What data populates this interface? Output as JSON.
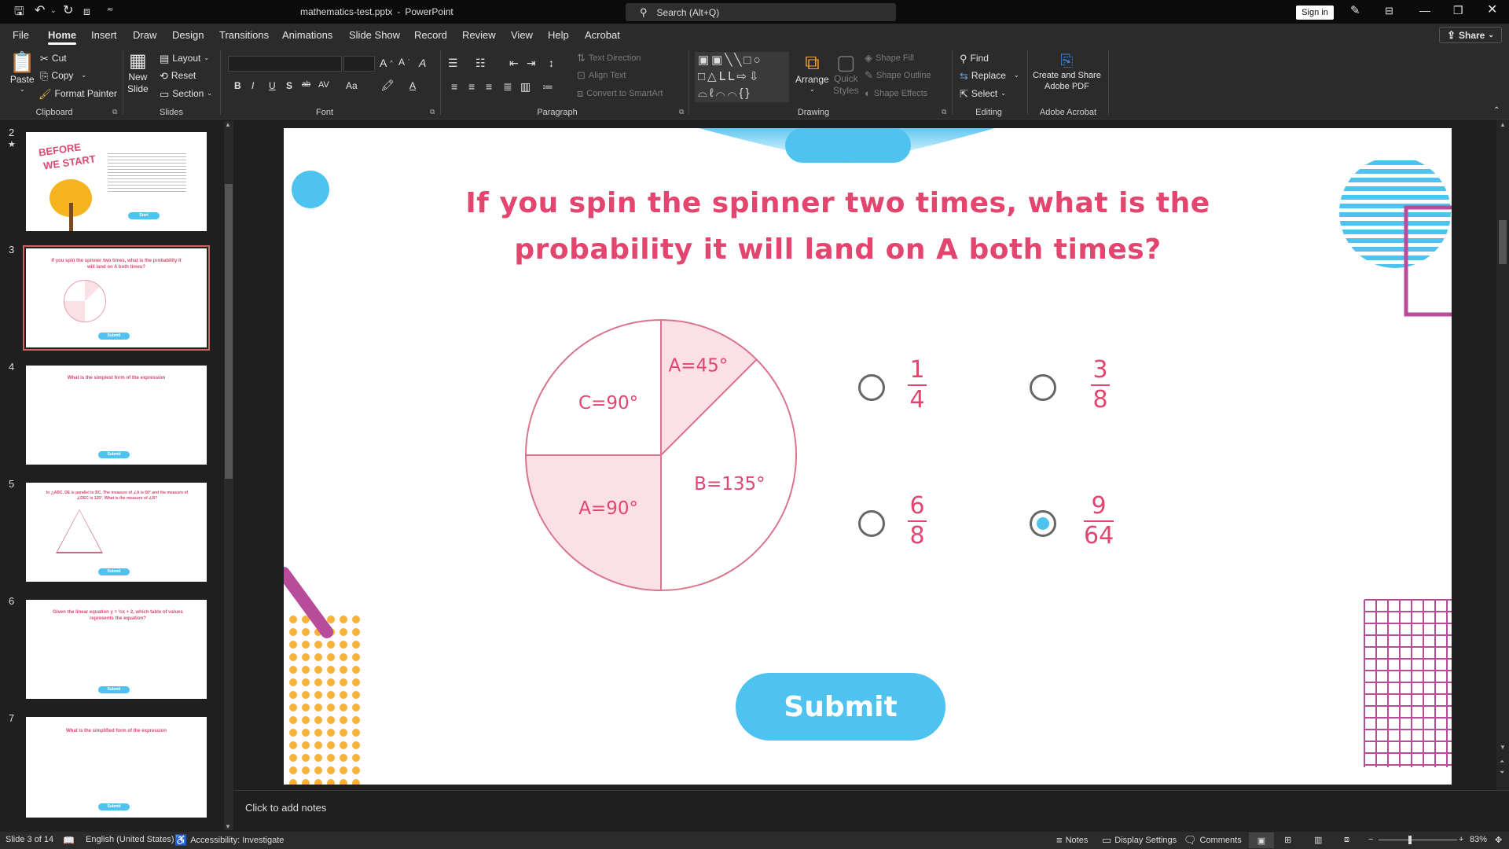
{
  "titlebar": {
    "document_title": "mathematics-test.pptx",
    "separator": "-",
    "app_name": "PowerPoint",
    "search_placeholder": "Search (Alt+Q)",
    "sign_in": "Sign in"
  },
  "tabs": [
    "File",
    "Home",
    "Insert",
    "Draw",
    "Design",
    "Transitions",
    "Animations",
    "Slide Show",
    "Record",
    "Review",
    "View",
    "Help",
    "Acrobat"
  ],
  "active_tab": "Home",
  "share_label": "Share",
  "ribbon": {
    "clipboard": {
      "paste": "Paste",
      "cut": "Cut",
      "copy": "Copy",
      "format_painter": "Format Painter",
      "label": "Clipboard"
    },
    "slides": {
      "new_slide_1": "New",
      "new_slide_2": "Slide",
      "layout": "Layout",
      "reset": "Reset",
      "section": "Section",
      "label": "Slides"
    },
    "font": {
      "label": "Font",
      "font_name": "",
      "font_size": ""
    },
    "paragraph": {
      "text_direction": "Text Direction",
      "align_text": "Align Text",
      "convert_smartart": "Convert to SmartArt",
      "label": "Paragraph"
    },
    "drawing": {
      "arrange": "Arrange",
      "quick_styles_1": "Quick",
      "quick_styles_2": "Styles",
      "shape_fill": "Shape Fill",
      "shape_outline": "Shape Outline",
      "shape_effects": "Shape Effects",
      "label": "Drawing"
    },
    "editing": {
      "find": "Find",
      "replace": "Replace",
      "select": "Select",
      "label": "Editing"
    },
    "acrobat": {
      "create_1": "Create and Share",
      "create_2": "Adobe PDF",
      "label": "Adobe Acrobat"
    }
  },
  "thumbnails": [
    {
      "number": "2",
      "starred": true,
      "title_1": "BEFORE",
      "title_2": "WE START",
      "button": "Start"
    },
    {
      "number": "3",
      "selected": true,
      "title": "If you spin the spinner two times, what is the probability it will land on A both times?",
      "button": "Submit"
    },
    {
      "number": "4",
      "title": "What is the simplest form of the expression",
      "button": "Submit"
    },
    {
      "number": "5",
      "title": "In △ABC, DE is parallel to BC. The measure of ∠A is 60° and the measure of ∠DEC is 125°. What is the measure of ∠B?",
      "button": "Submit"
    },
    {
      "number": "6",
      "title": "Given the linear equation y = ½x + 2, which table of values represents the equation?",
      "button": "Submit"
    },
    {
      "number": "7",
      "title": "What is the simplified form of the expression",
      "button": "Submit"
    }
  ],
  "slide": {
    "question_line_1": "If you spin the spinner two times, what is the",
    "question_line_2": "probability it will land on A both times?",
    "spinner_sectors": [
      {
        "label": "A=45°",
        "degrees": 45,
        "shaded": true
      },
      {
        "label": "B=135°",
        "degrees": 135,
        "shaded": false
      },
      {
        "label": "A=90°",
        "degrees": 90,
        "shaded": true
      },
      {
        "label": "C=90°",
        "degrees": 90,
        "shaded": false
      }
    ],
    "options": [
      {
        "numerator": "1",
        "denominator": "4",
        "selected": false
      },
      {
        "numerator": "3",
        "denominator": "8",
        "selected": false
      },
      {
        "numerator": "6",
        "denominator": "8",
        "selected": false
      },
      {
        "numerator": "9",
        "denominator": "64",
        "selected": true
      }
    ],
    "submit_label": "Submit",
    "colors": {
      "accent_pink": "#e2456e",
      "accent_blue": "#4fc3f0",
      "sector_fill": "#fbe0e6",
      "sector_stroke": "#d9768f",
      "decor_magenta": "#b84c9a",
      "decor_orange": "#f6b23c"
    }
  },
  "notes_placeholder": "Click to add notes",
  "statusbar": {
    "slide_indicator": "Slide 3 of 14",
    "language": "English (United States)",
    "accessibility": "Accessibility: Investigate",
    "notes": "Notes",
    "display_settings": "Display Settings",
    "comments": "Comments",
    "zoom": "83%"
  }
}
